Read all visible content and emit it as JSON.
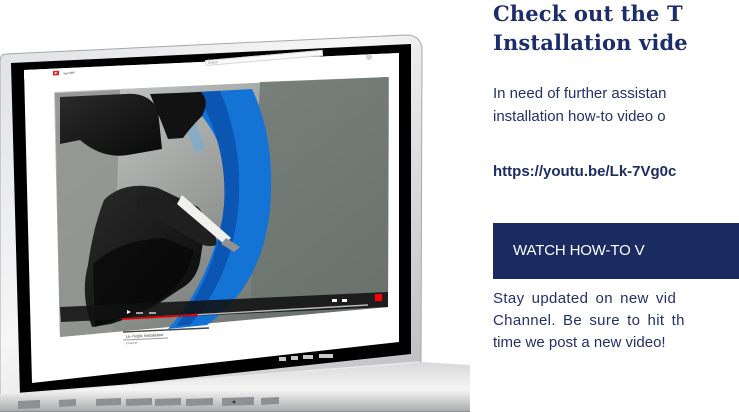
{
  "laptop": {
    "screen": {
      "logo_text": "YouTube",
      "search_placeholder": "Search",
      "video_title": "Lk-7Vg0c Installation",
      "channel_name": "Channel"
    }
  },
  "panel": {
    "title_line1": "Check out the T",
    "title_line2": "Installation vide",
    "intro_line1": "In need of further assistan",
    "intro_line2": "installation how-to video o",
    "url": "https://youtu.be/Lk-7Vg0c",
    "button_label": "WATCH HOW-TO V",
    "outro_line1": "Stay updated on new vid",
    "outro_line2": "Channel. Be sure to hit th",
    "outro_line3": "time we post a new video!"
  }
}
